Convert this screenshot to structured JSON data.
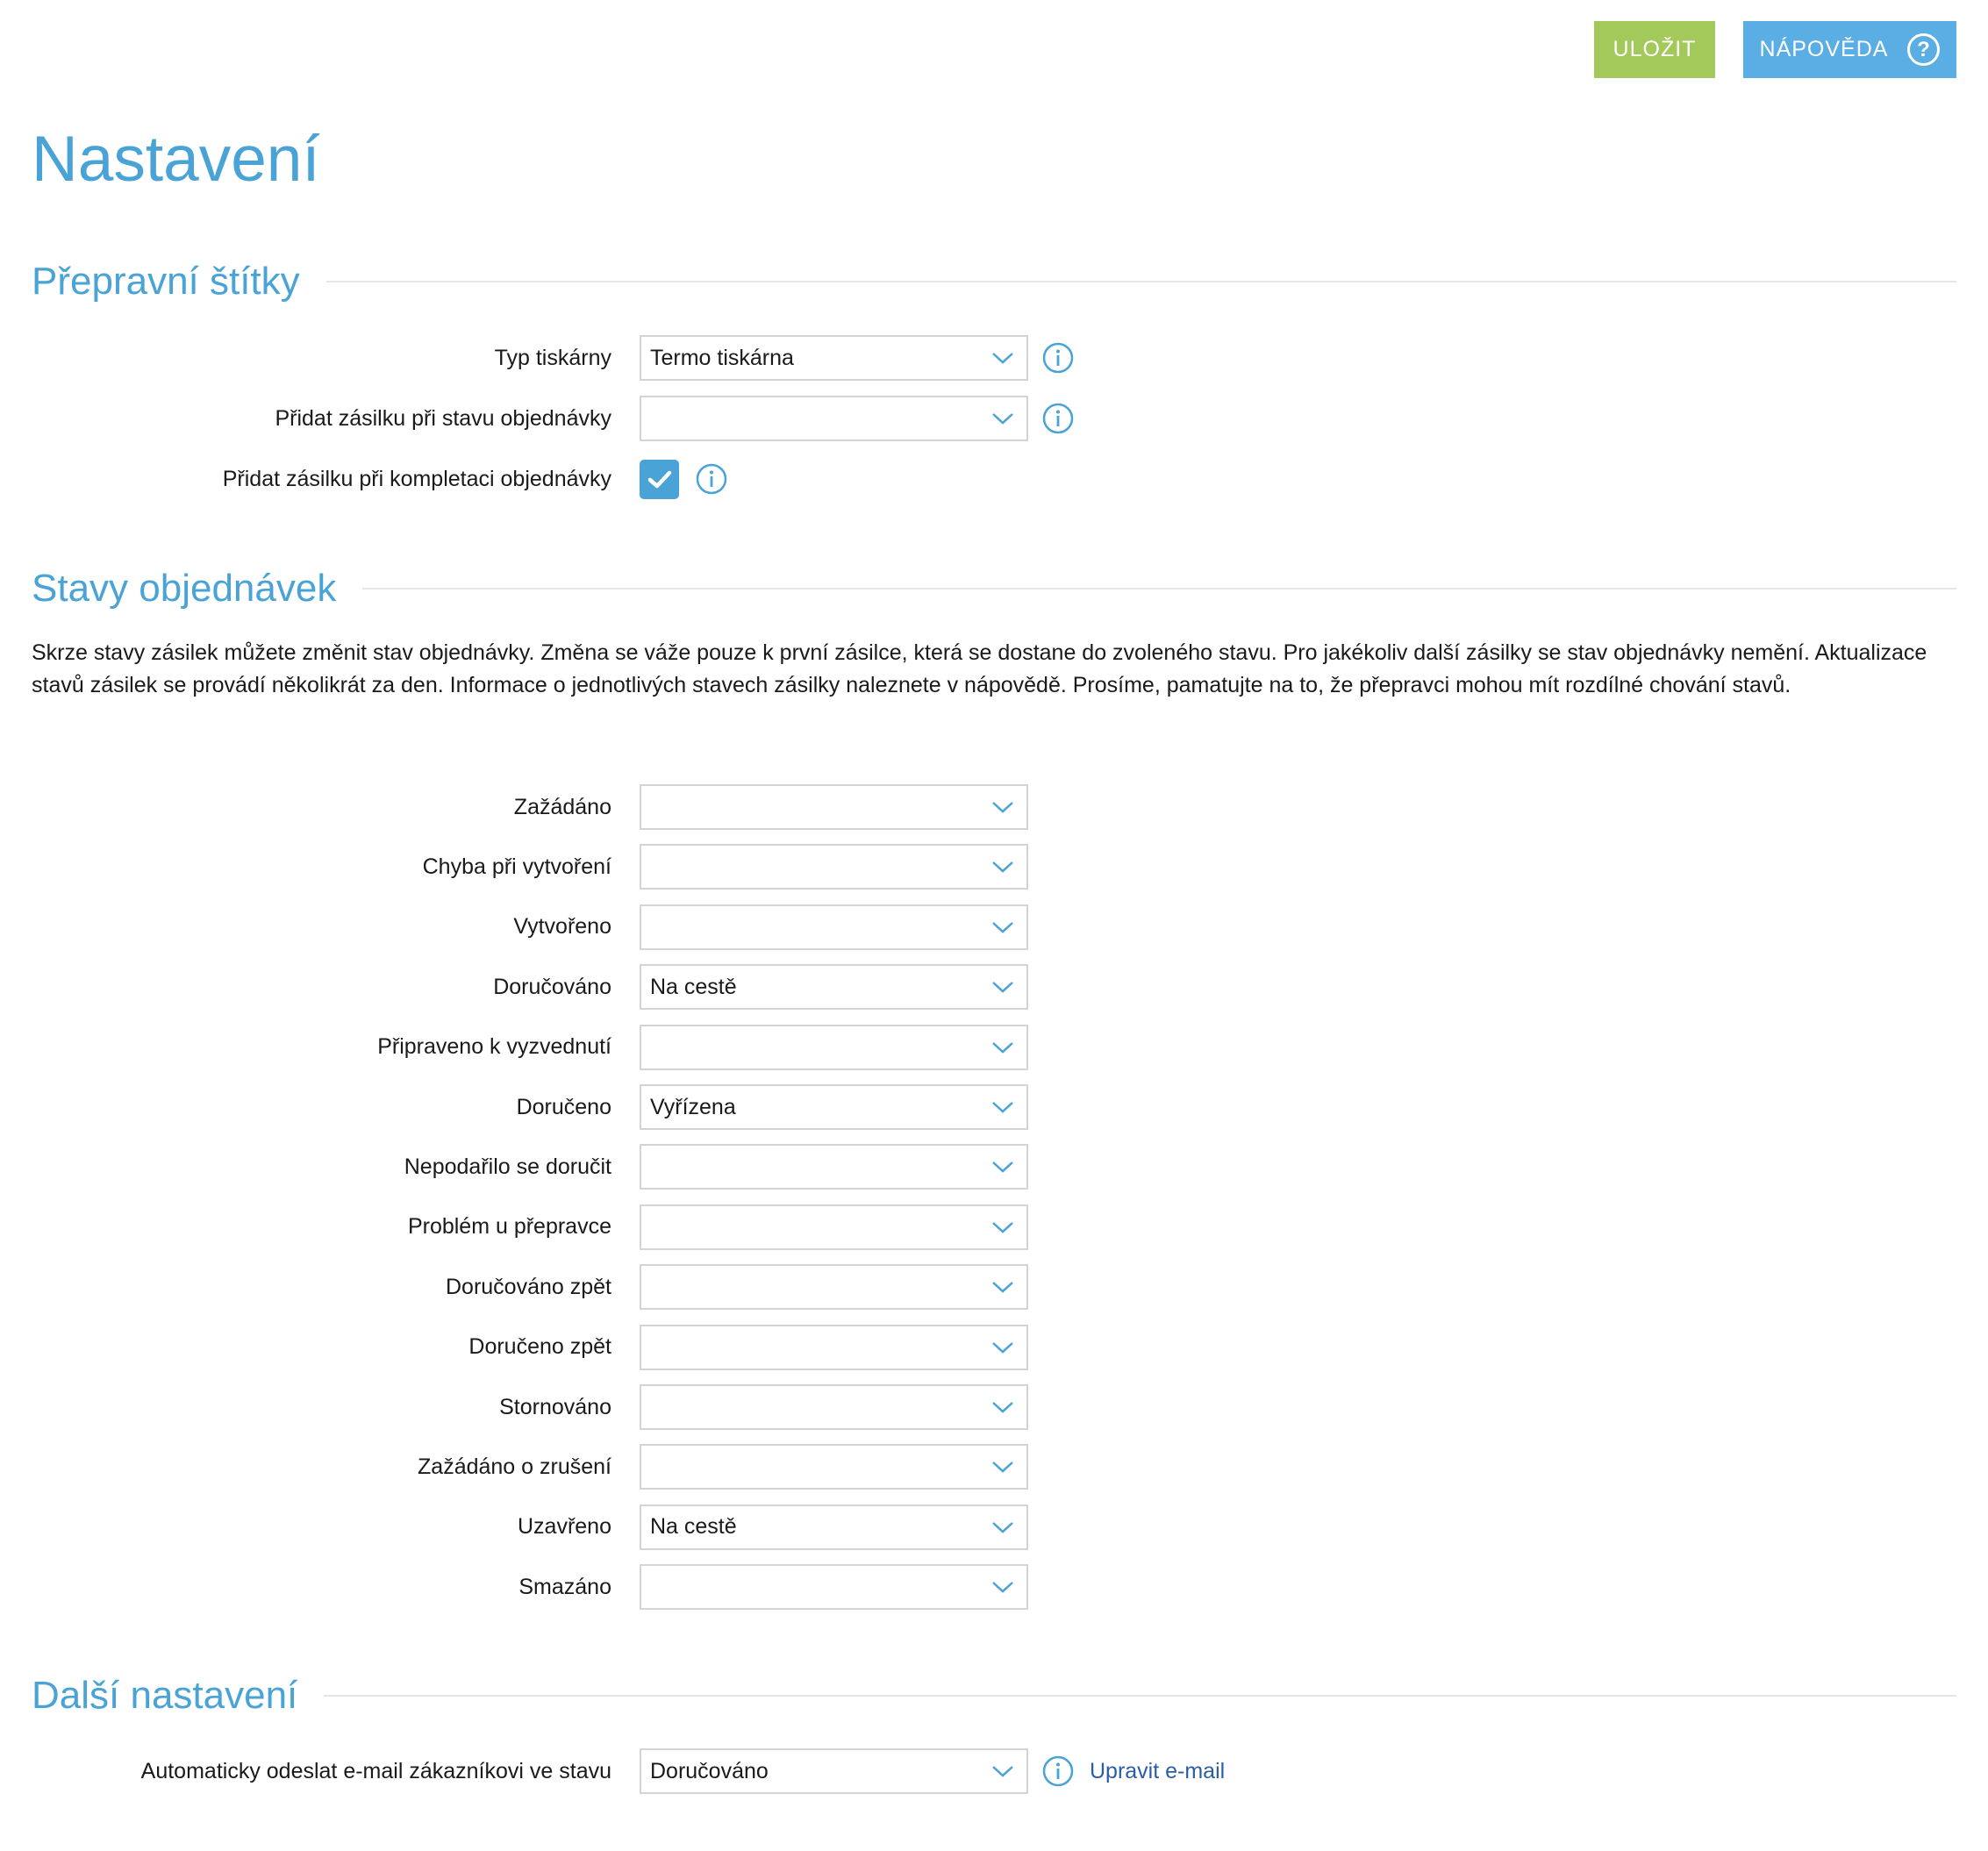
{
  "toolbar": {
    "save_label": "ULOŽIT",
    "help_label": "NÁPOVĚDA",
    "help_glyph": "?"
  },
  "page": {
    "title": "Nastavení"
  },
  "labels_section": {
    "title": "Přepravní štítky",
    "printer_label": "Typ tiskárny",
    "printer_value": "Termo tiskárna",
    "add_on_status_label": "Přidat zásilku při stavu objednávky",
    "add_on_status_value": "",
    "add_on_complete_label": "Přidat zásilku při kompletaci objednávky",
    "add_on_complete_checked": true
  },
  "states_section": {
    "title": "Stavy objednávek",
    "description": "Skrze stavy zásilek můžete změnit stav objednávky. Změna se váže pouze k první zásilce, která se dostane do zvoleného stavu. Pro jakékoliv další zásilky se stav objednávky nemění. Aktualizace stavů zásilek se provádí několikrát za den. Informace o jednotlivých stavech zásilky naleznete v nápovědě. Prosíme, pamatujte na to, že přepravci mohou mít rozdílné chování stavů.",
    "rows": [
      {
        "label": "Zažádáno",
        "value": ""
      },
      {
        "label": "Chyba při vytvoření",
        "value": ""
      },
      {
        "label": "Vytvořeno",
        "value": ""
      },
      {
        "label": "Doručováno",
        "value": "Na cestě"
      },
      {
        "label": "Připraveno k vyzvednutí",
        "value": ""
      },
      {
        "label": "Doručeno",
        "value": "Vyřízena"
      },
      {
        "label": "Nepodařilo se doručit",
        "value": ""
      },
      {
        "label": "Problém u přepravce",
        "value": ""
      },
      {
        "label": "Doručováno zpět",
        "value": ""
      },
      {
        "label": "Doručeno zpět",
        "value": ""
      },
      {
        "label": "Stornováno",
        "value": ""
      },
      {
        "label": "Zažádáno o zrušení",
        "value": ""
      },
      {
        "label": "Uzavřeno",
        "value": "Na cestě"
      },
      {
        "label": "Smazáno",
        "value": ""
      }
    ]
  },
  "other_section": {
    "title": "Další nastavení",
    "email_label": "Automaticky odeslat e-mail zákazníkovi ve stavu",
    "email_value": "Doručováno",
    "edit_email_link": "Upravit e-mail"
  },
  "colors": {
    "accent": "#4aa3d6",
    "save": "#a3c95b",
    "help": "#5aaee3",
    "link": "#2a5da8"
  },
  "icons": [
    "help-icon",
    "info-icon",
    "chevron-down-icon",
    "checkmark-icon"
  ]
}
